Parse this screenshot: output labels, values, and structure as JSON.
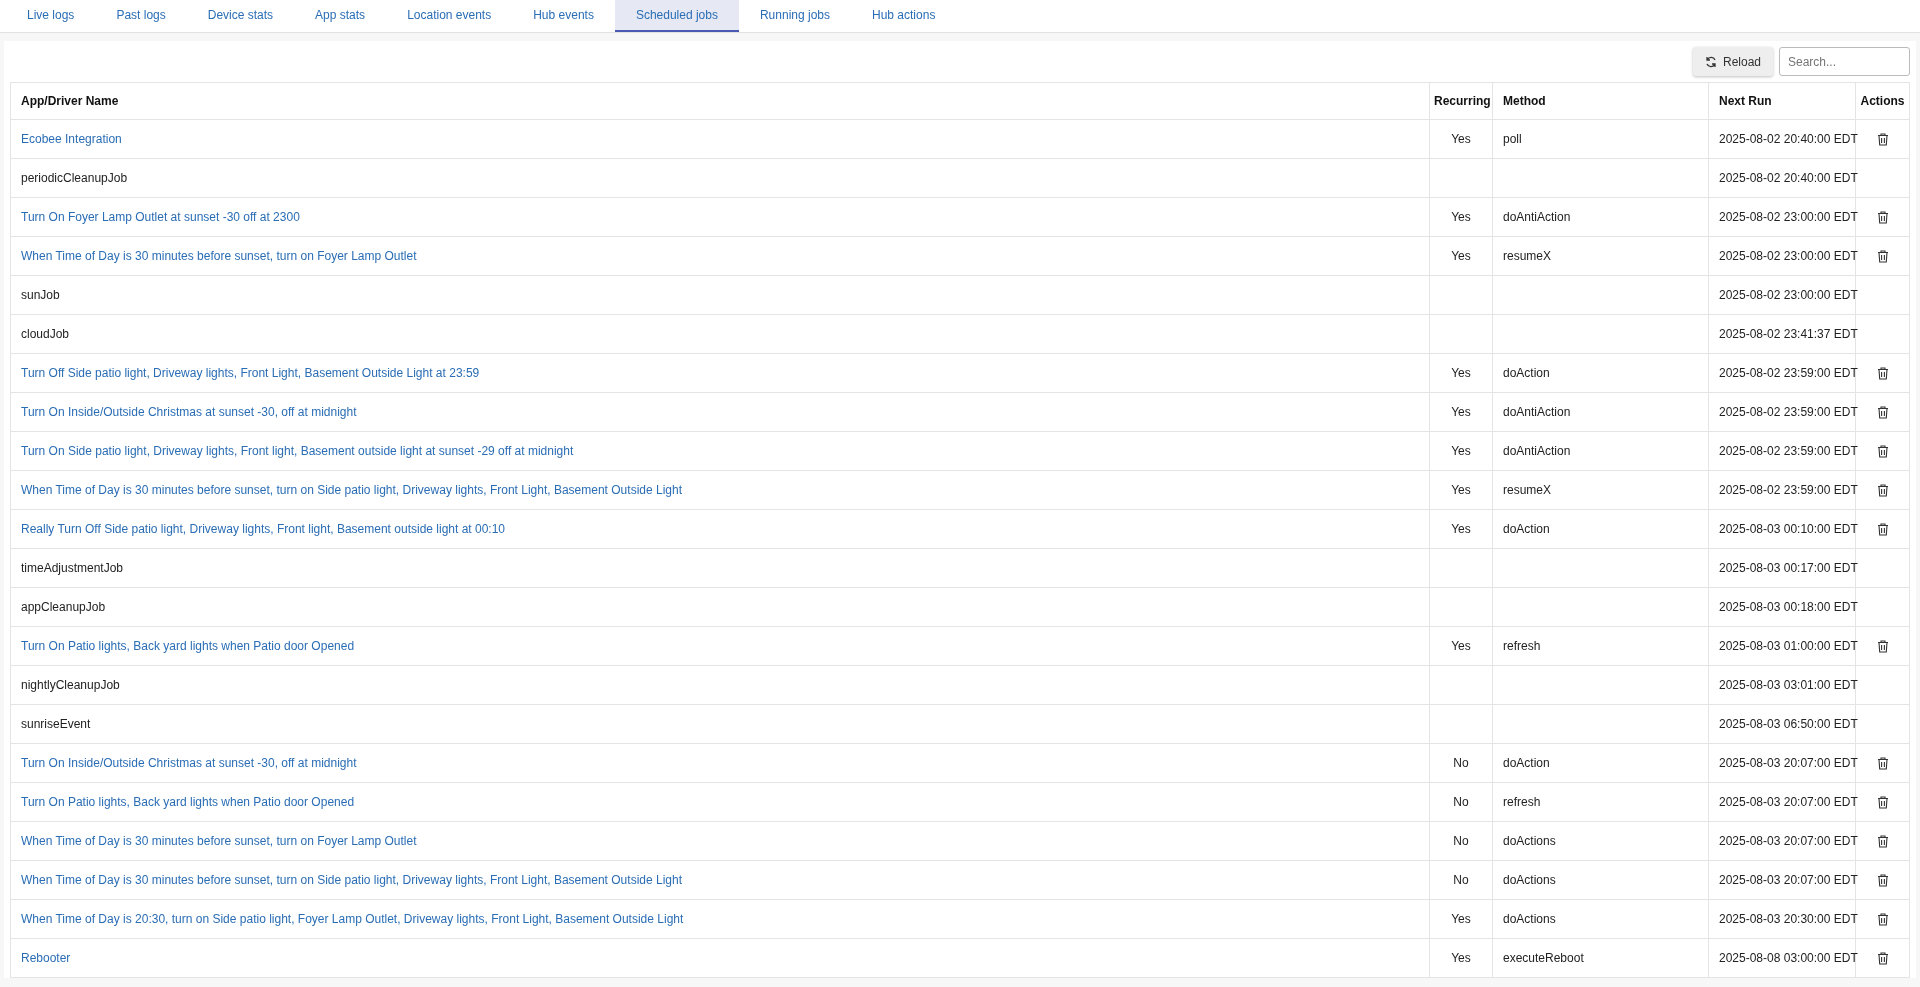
{
  "tabs": [
    {
      "label": "Live logs",
      "selected": false
    },
    {
      "label": "Past logs",
      "selected": false
    },
    {
      "label": "Device stats",
      "selected": false
    },
    {
      "label": "App stats",
      "selected": false
    },
    {
      "label": "Location events",
      "selected": false
    },
    {
      "label": "Hub events",
      "selected": false
    },
    {
      "label": "Scheduled jobs",
      "selected": true
    },
    {
      "label": "Running jobs",
      "selected": false
    },
    {
      "label": "Hub actions",
      "selected": false
    }
  ],
  "toolbar": {
    "reload_button": "Reload",
    "search": {
      "placeholder": "Search..."
    }
  },
  "table": {
    "columns": [
      "App/Driver Name",
      "Recurring",
      "Method",
      "Next Run",
      "Actions"
    ],
    "rows": [
      {
        "kind": "app",
        "name": "Ecobee Integration",
        "recurring": "Yes",
        "method": "poll",
        "next_run": "2025-08-02 20:40:00 EDT"
      },
      {
        "kind": "system",
        "name": "periodicCleanupJob",
        "next_run": "2025-08-02 20:40:00 EDT"
      },
      {
        "kind": "app",
        "name": "Turn On Foyer Lamp Outlet at sunset -30 off at 2300",
        "recurring": "Yes",
        "method": "doAntiAction",
        "next_run": "2025-08-02 23:00:00 EDT"
      },
      {
        "kind": "app",
        "name": "When Time of Day is 30 minutes before sunset, turn on Foyer Lamp Outlet",
        "recurring": "Yes",
        "method": "resumeX",
        "next_run": "2025-08-02 23:00:00 EDT"
      },
      {
        "kind": "system",
        "name": "sunJob",
        "next_run": "2025-08-02 23:00:00 EDT"
      },
      {
        "kind": "system",
        "name": "cloudJob",
        "next_run": "2025-08-02 23:41:37 EDT"
      },
      {
        "kind": "app",
        "name": "Turn Off Side patio light, Driveway lights, Front Light, Basement Outside Light at 23:59",
        "recurring": "Yes",
        "method": "doAction",
        "next_run": "2025-08-02 23:59:00 EDT"
      },
      {
        "kind": "app",
        "name": "Turn On Inside/Outside Christmas at sunset -30, off at midnight",
        "recurring": "Yes",
        "method": "doAntiAction",
        "next_run": "2025-08-02 23:59:00 EDT"
      },
      {
        "kind": "app",
        "name": "Turn On Side patio light, Driveway lights, Front light, Basement outside light at sunset -29 off at midnight",
        "recurring": "Yes",
        "method": "doAntiAction",
        "next_run": "2025-08-02 23:59:00 EDT"
      },
      {
        "kind": "app",
        "name": "When Time of Day is 30 minutes before sunset, turn on Side patio light, Driveway lights, Front Light, Basement Outside Light",
        "recurring": "Yes",
        "method": "resumeX",
        "next_run": "2025-08-02 23:59:00 EDT"
      },
      {
        "kind": "app",
        "name": "Really Turn Off Side patio light, Driveway lights, Front light, Basement outside light at 00:10",
        "recurring": "Yes",
        "method": "doAction",
        "next_run": "2025-08-03 00:10:00 EDT"
      },
      {
        "kind": "system",
        "name": "timeAdjustmentJob",
        "next_run": "2025-08-03 00:17:00 EDT"
      },
      {
        "kind": "system",
        "name": "appCleanupJob",
        "next_run": "2025-08-03 00:18:00 EDT"
      },
      {
        "kind": "app",
        "name": "Turn On Patio lights, Back yard lights when Patio door Opened",
        "recurring": "Yes",
        "method": "refresh",
        "next_run": "2025-08-03 01:00:00 EDT"
      },
      {
        "kind": "system",
        "name": "nightlyCleanupJob",
        "next_run": "2025-08-03 03:01:00 EDT"
      },
      {
        "kind": "system",
        "name": "sunriseEvent",
        "next_run": "2025-08-03 06:50:00 EDT"
      },
      {
        "kind": "app",
        "name": "Turn On Inside/Outside Christmas at sunset -30, off at midnight",
        "recurring": "No",
        "method": "doAction",
        "next_run": "2025-08-03 20:07:00 EDT"
      },
      {
        "kind": "app",
        "name": "Turn On Patio lights, Back yard lights when Patio door Opened",
        "recurring": "No",
        "method": "refresh",
        "next_run": "2025-08-03 20:07:00 EDT"
      },
      {
        "kind": "app",
        "name": "When Time of Day is 30 minutes before sunset, turn on Foyer Lamp Outlet",
        "recurring": "No",
        "method": "doActions",
        "next_run": "2025-08-03 20:07:00 EDT"
      },
      {
        "kind": "app",
        "name": "When Time of Day is 30 minutes before sunset, turn on Side patio light, Driveway lights, Front Light, Basement Outside Light",
        "recurring": "No",
        "method": "doActions",
        "next_run": "2025-08-03 20:07:00 EDT"
      },
      {
        "kind": "app",
        "name": "When Time of Day is 20:30, turn on Side patio light, Foyer Lamp Outlet, Driveway lights, Front Light, Basement Outside Light",
        "recurring": "Yes",
        "method": "doActions",
        "next_run": "2025-08-03 20:30:00 EDT"
      },
      {
        "kind": "app",
        "name": "Rebooter",
        "recurring": "Yes",
        "method": "executeReboot",
        "next_run": "2025-08-08 03:00:00 EDT"
      }
    ]
  }
}
